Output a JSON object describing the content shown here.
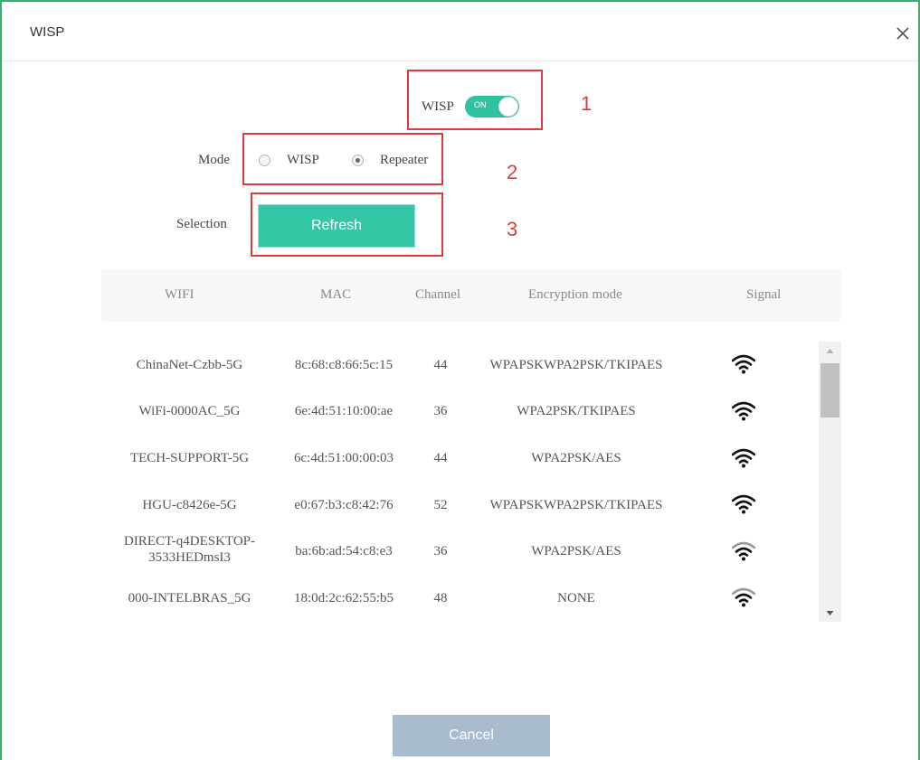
{
  "dialog": {
    "title": "WISP",
    "close_icon": "close-icon"
  },
  "annotations": [
    "1",
    "2",
    "3"
  ],
  "wisp_toggle": {
    "label": "WISP",
    "state_text": "ON",
    "on": true,
    "color": "#2fc1a0"
  },
  "mode": {
    "label": "Mode",
    "options": [
      {
        "label": "WISP",
        "checked": false
      },
      {
        "label": "Repeater",
        "checked": true
      }
    ]
  },
  "selection": {
    "label": "Selection",
    "refresh_label": "Refresh",
    "refresh_color": "#35c6a5"
  },
  "table": {
    "headers": [
      "WIFI",
      "MAC",
      "Channel",
      "Encryption mode",
      "Signal"
    ],
    "rows": [
      {
        "wifi": "ChinaNet-Czbb-5G",
        "mac": "8c:68:c8:66:5c:15",
        "channel": "44",
        "encryption": "WPAPSKWPA2PSK/TKIPAES",
        "signal": "strong"
      },
      {
        "wifi": "WiFi-0000AC_5G",
        "mac": "6e:4d:51:10:00:ae",
        "channel": "36",
        "encryption": "WPA2PSK/TKIPAES",
        "signal": "strong"
      },
      {
        "wifi": "TECH-SUPPORT-5G",
        "mac": "6c:4d:51:00:00:03",
        "channel": "44",
        "encryption": "WPA2PSK/AES",
        "signal": "strong"
      },
      {
        "wifi": "HGU-c8426e-5G",
        "mac": "e0:67:b3:c8:42:76",
        "channel": "52",
        "encryption": "WPAPSKWPA2PSK/TKIPAES",
        "signal": "strong"
      },
      {
        "wifi": "DIRECT-q4DESKTOP-3533HEDmsI3",
        "mac": "ba:6b:ad:54:c8:e3",
        "channel": "36",
        "encryption": "WPA2PSK/AES",
        "signal": "medium"
      },
      {
        "wifi": "000-INTELBRAS_5G",
        "mac": "18:0d:2c:62:55:b5",
        "channel": "48",
        "encryption": "NONE",
        "signal": "medium"
      }
    ]
  },
  "cancel_label": "Cancel",
  "colors": {
    "accent": "#35c6a5",
    "annotation": "#e03a3a",
    "cancel": "#a8bccd"
  }
}
